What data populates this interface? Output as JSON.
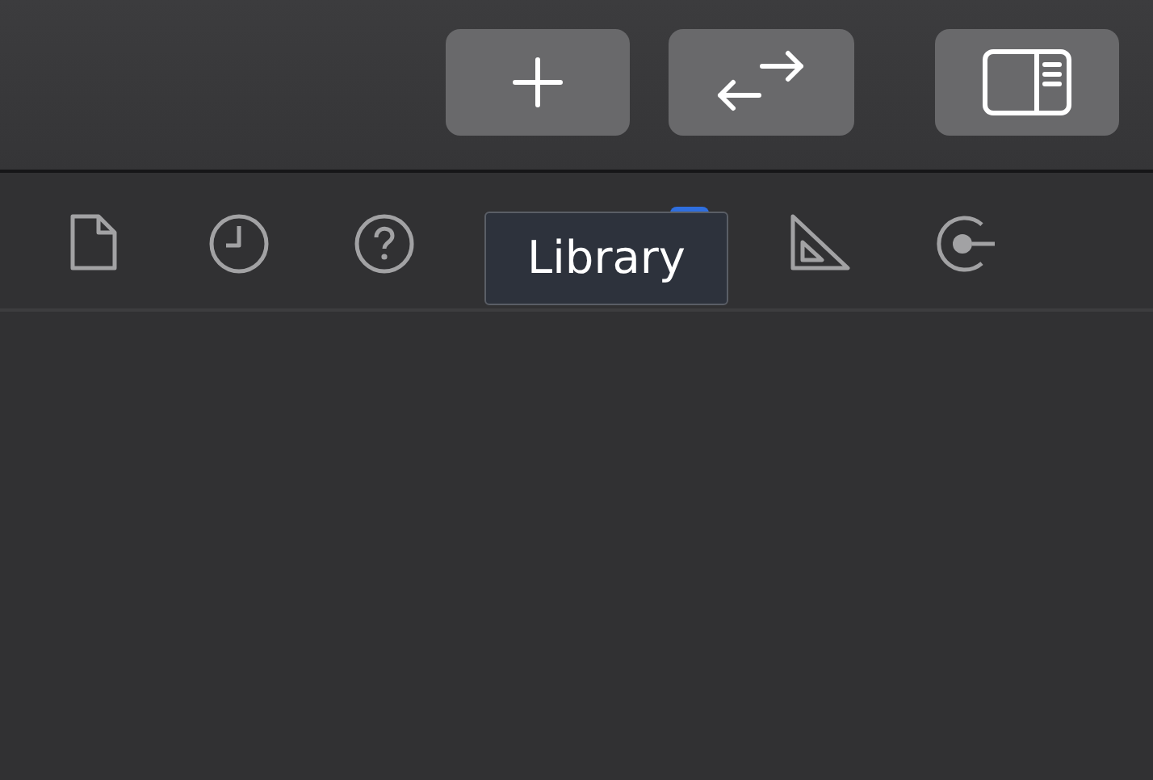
{
  "toolbar": {
    "buttons": [
      {
        "kind": "add"
      },
      {
        "kind": "swap"
      },
      {
        "kind": "panel"
      }
    ]
  },
  "inspector_tabs": [
    {
      "kind": "file",
      "selected": false
    },
    {
      "kind": "history",
      "selected": false
    },
    {
      "kind": "help",
      "selected": false
    },
    {
      "kind": "library",
      "selected": true
    },
    {
      "kind": "ruler",
      "selected": false
    },
    {
      "kind": "connect",
      "selected": false
    }
  ],
  "tooltip": {
    "text": "Library"
  }
}
